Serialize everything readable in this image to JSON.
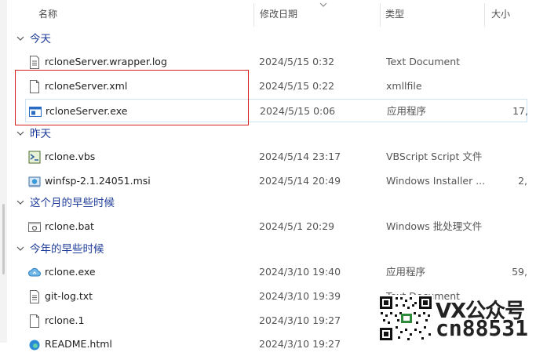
{
  "header": {
    "col_name": "名称",
    "col_date": "修改日期",
    "col_type": "类型",
    "col_size": "大小"
  },
  "groups": [
    {
      "label": "今天",
      "rows": [
        {
          "name": "rcloneServer.wrapper.log",
          "date": "2024/5/15 0:32",
          "type": "Text Document",
          "size": "",
          "icon": "text-file-icon"
        },
        {
          "name": "rcloneServer.xml",
          "date": "2024/5/15 0:22",
          "type": "xmllfile",
          "size": "",
          "icon": "blank-file-icon"
        },
        {
          "name": "rcloneServer.exe",
          "date": "2024/5/15 0:06",
          "type": "应用程序",
          "size": "17,",
          "icon": "exe-window-icon"
        }
      ]
    },
    {
      "label": "昨天",
      "rows": [
        {
          "name": "rclone.vbs",
          "date": "2024/5/14 23:17",
          "type": "VBScript Script 文件",
          "size": "",
          "icon": "vbs-script-icon"
        },
        {
          "name": "winfsp-2.1.24051.msi",
          "date": "2024/5/14 20:49",
          "type": "Windows Installer ...",
          "size": "2,",
          "icon": "msi-installer-icon"
        }
      ]
    },
    {
      "label": "这个月的早些时候",
      "rows": [
        {
          "name": "rclone.bat",
          "date": "2024/5/1 20:29",
          "type": "Windows 批处理文件",
          "size": "",
          "icon": "bat-gear-icon"
        }
      ]
    },
    {
      "label": "今年的早些时候",
      "rows": [
        {
          "name": "rclone.exe",
          "date": "2024/3/10 19:40",
          "type": "应用程序",
          "size": "59,",
          "icon": "rclone-cloud-icon"
        },
        {
          "name": "git-log.txt",
          "date": "2024/3/10 19:39",
          "type": "Text Document",
          "size": "",
          "icon": "text-file-icon"
        },
        {
          "name": "rclone.1",
          "date": "2024/3/10 19:27",
          "type": "",
          "size": "",
          "icon": "blank-file-icon"
        },
        {
          "name": "README.html",
          "date": "2024/3/10 19:27",
          "type": "",
          "size": "",
          "icon": "html-edge-icon"
        }
      ]
    }
  ],
  "watermark": {
    "line1": "VX公众号",
    "line2": "cn88531"
  }
}
